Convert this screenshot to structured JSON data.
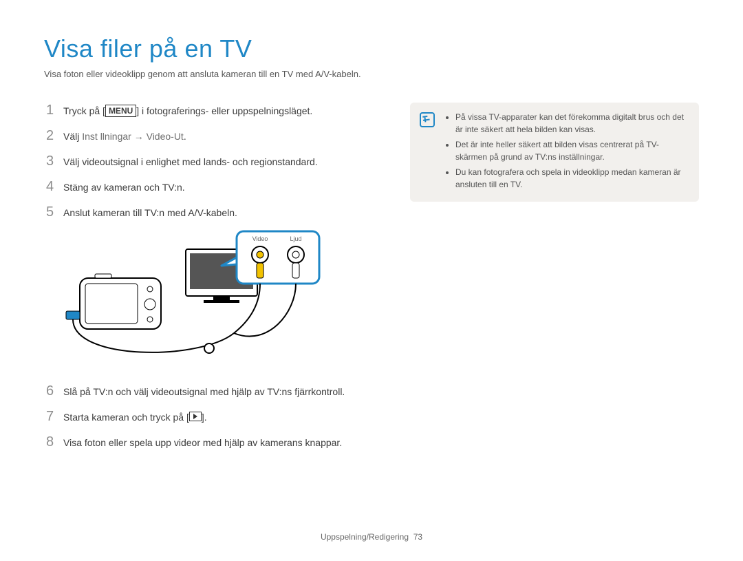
{
  "title": "Visa filer på en TV",
  "subtitle": "Visa foton eller videoklipp genom att ansluta kameran till en TV med A/V-kabeln.",
  "menu_token": "MENU",
  "steps": {
    "s1": {
      "num": "1",
      "pre": "Tryck på [",
      "post": "] i fotograferings- eller uppspelningsläget."
    },
    "s2": {
      "num": "2",
      "pre": "Välj ",
      "path": "Inst  llningar → Video-Ut",
      "post": "."
    },
    "s3": {
      "num": "3",
      "text": "Välj videoutsignal i enlighet med lands- och regionstandard."
    },
    "s4": {
      "num": "4",
      "text": "Stäng av kameran och TV:n."
    },
    "s5": {
      "num": "5",
      "text": "Anslut kameran till TV:n med A/V-kabeln."
    },
    "s6": {
      "num": "6",
      "text": "Slå på TV:n och välj videoutsignal med hjälp av TV:ns fjärrkontroll."
    },
    "s7": {
      "num": "7",
      "pre": "Starta kameran och tryck på [",
      "post": "]."
    },
    "s8": {
      "num": "8",
      "text": "Visa foton eller spela upp videor med hjälp av kamerans knappar."
    }
  },
  "diagram": {
    "video_label": "Video",
    "audio_label": "Ljud"
  },
  "notes": {
    "n1": "På vissa TV-apparater kan det förekomma digitalt brus och det är inte säkert att hela bilden kan visas.",
    "n2": "Det är inte heller säkert att bilden visas centrerat på TV-skärmen på grund av TV:ns inställningar.",
    "n3": "Du kan fotografera och spela in videoklipp medan kameran är ansluten till en TV."
  },
  "footer": {
    "section": "Uppspelning/Redigering",
    "page": "73"
  }
}
